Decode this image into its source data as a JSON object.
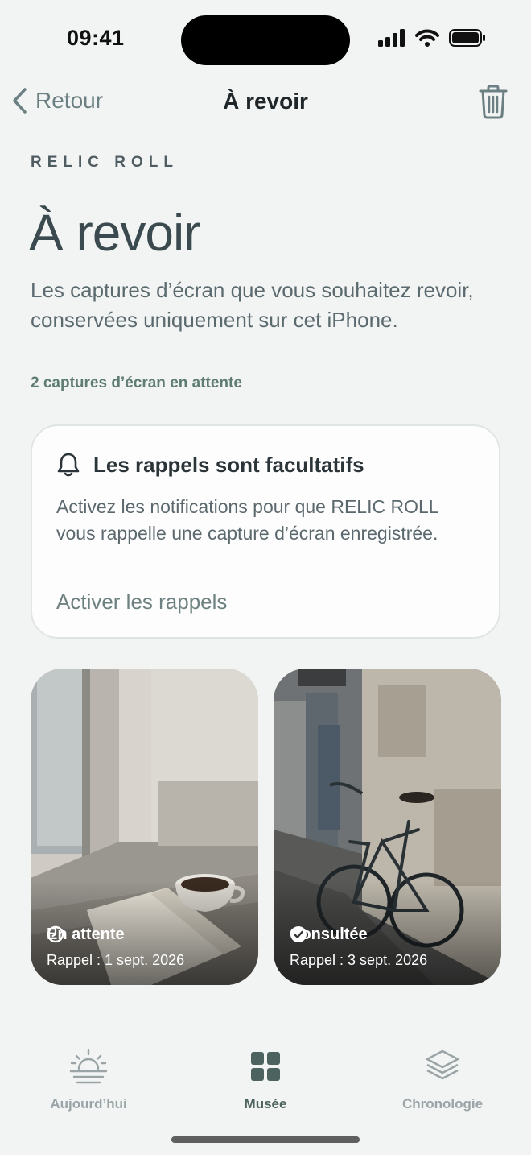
{
  "status_bar": {
    "time": "09:41"
  },
  "nav": {
    "back_label": "Retour",
    "title": "À revoir"
  },
  "header": {
    "eyebrow": "RELIC ROLL",
    "title": "À revoir",
    "description": "Les captures d’écran que vous souhaitez revoir, conservées uniquement sur cet iPhone.",
    "count": "2 captures d’écran en attente"
  },
  "reminder_card": {
    "title": "Les rappels sont facultatifs",
    "text": "Activez les notifications pour que RELIC ROLL vous rappelle une capture d’écran enregistrée.",
    "link": "Activer les rappels"
  },
  "items": [
    {
      "status": "En attente",
      "date": "Rappel : 1 sept. 2026",
      "icon": "clock-icon"
    },
    {
      "status": "Consultée",
      "date": "Rappel : 3 sept. 2026",
      "icon": "check-circle-icon"
    }
  ],
  "tabs": [
    {
      "label": "Aujourd’hui",
      "icon": "sunrise-icon",
      "active": false
    },
    {
      "label": "Musée",
      "icon": "grid-icon",
      "active": true
    },
    {
      "label": "Chronologie",
      "icon": "layers-icon",
      "active": false
    }
  ],
  "colors": {
    "accent": "#5e7c73",
    "active_tab": "#4d6360",
    "inactive_tab": "#9aa4a6"
  }
}
